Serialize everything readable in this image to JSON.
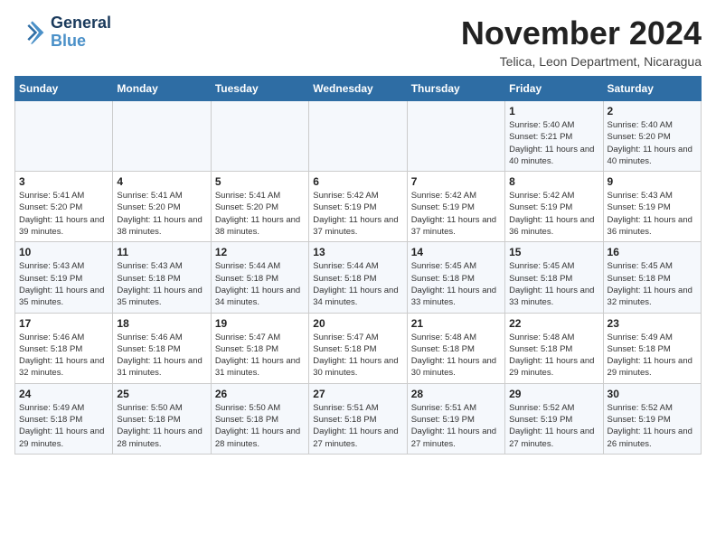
{
  "logo": {
    "line1": "General",
    "line2": "Blue"
  },
  "title": "November 2024",
  "subtitle": "Telica, Leon Department, Nicaragua",
  "weekdays": [
    "Sunday",
    "Monday",
    "Tuesday",
    "Wednesday",
    "Thursday",
    "Friday",
    "Saturday"
  ],
  "weeks": [
    [
      {
        "day": "",
        "info": ""
      },
      {
        "day": "",
        "info": ""
      },
      {
        "day": "",
        "info": ""
      },
      {
        "day": "",
        "info": ""
      },
      {
        "day": "",
        "info": ""
      },
      {
        "day": "1",
        "info": "Sunrise: 5:40 AM\nSunset: 5:21 PM\nDaylight: 11 hours and 40 minutes."
      },
      {
        "day": "2",
        "info": "Sunrise: 5:40 AM\nSunset: 5:20 PM\nDaylight: 11 hours and 40 minutes."
      }
    ],
    [
      {
        "day": "3",
        "info": "Sunrise: 5:41 AM\nSunset: 5:20 PM\nDaylight: 11 hours and 39 minutes."
      },
      {
        "day": "4",
        "info": "Sunrise: 5:41 AM\nSunset: 5:20 PM\nDaylight: 11 hours and 38 minutes."
      },
      {
        "day": "5",
        "info": "Sunrise: 5:41 AM\nSunset: 5:20 PM\nDaylight: 11 hours and 38 minutes."
      },
      {
        "day": "6",
        "info": "Sunrise: 5:42 AM\nSunset: 5:19 PM\nDaylight: 11 hours and 37 minutes."
      },
      {
        "day": "7",
        "info": "Sunrise: 5:42 AM\nSunset: 5:19 PM\nDaylight: 11 hours and 37 minutes."
      },
      {
        "day": "8",
        "info": "Sunrise: 5:42 AM\nSunset: 5:19 PM\nDaylight: 11 hours and 36 minutes."
      },
      {
        "day": "9",
        "info": "Sunrise: 5:43 AM\nSunset: 5:19 PM\nDaylight: 11 hours and 36 minutes."
      }
    ],
    [
      {
        "day": "10",
        "info": "Sunrise: 5:43 AM\nSunset: 5:19 PM\nDaylight: 11 hours and 35 minutes."
      },
      {
        "day": "11",
        "info": "Sunrise: 5:43 AM\nSunset: 5:18 PM\nDaylight: 11 hours and 35 minutes."
      },
      {
        "day": "12",
        "info": "Sunrise: 5:44 AM\nSunset: 5:18 PM\nDaylight: 11 hours and 34 minutes."
      },
      {
        "day": "13",
        "info": "Sunrise: 5:44 AM\nSunset: 5:18 PM\nDaylight: 11 hours and 34 minutes."
      },
      {
        "day": "14",
        "info": "Sunrise: 5:45 AM\nSunset: 5:18 PM\nDaylight: 11 hours and 33 minutes."
      },
      {
        "day": "15",
        "info": "Sunrise: 5:45 AM\nSunset: 5:18 PM\nDaylight: 11 hours and 33 minutes."
      },
      {
        "day": "16",
        "info": "Sunrise: 5:45 AM\nSunset: 5:18 PM\nDaylight: 11 hours and 32 minutes."
      }
    ],
    [
      {
        "day": "17",
        "info": "Sunrise: 5:46 AM\nSunset: 5:18 PM\nDaylight: 11 hours and 32 minutes."
      },
      {
        "day": "18",
        "info": "Sunrise: 5:46 AM\nSunset: 5:18 PM\nDaylight: 11 hours and 31 minutes."
      },
      {
        "day": "19",
        "info": "Sunrise: 5:47 AM\nSunset: 5:18 PM\nDaylight: 11 hours and 31 minutes."
      },
      {
        "day": "20",
        "info": "Sunrise: 5:47 AM\nSunset: 5:18 PM\nDaylight: 11 hours and 30 minutes."
      },
      {
        "day": "21",
        "info": "Sunrise: 5:48 AM\nSunset: 5:18 PM\nDaylight: 11 hours and 30 minutes."
      },
      {
        "day": "22",
        "info": "Sunrise: 5:48 AM\nSunset: 5:18 PM\nDaylight: 11 hours and 29 minutes."
      },
      {
        "day": "23",
        "info": "Sunrise: 5:49 AM\nSunset: 5:18 PM\nDaylight: 11 hours and 29 minutes."
      }
    ],
    [
      {
        "day": "24",
        "info": "Sunrise: 5:49 AM\nSunset: 5:18 PM\nDaylight: 11 hours and 29 minutes."
      },
      {
        "day": "25",
        "info": "Sunrise: 5:50 AM\nSunset: 5:18 PM\nDaylight: 11 hours and 28 minutes."
      },
      {
        "day": "26",
        "info": "Sunrise: 5:50 AM\nSunset: 5:18 PM\nDaylight: 11 hours and 28 minutes."
      },
      {
        "day": "27",
        "info": "Sunrise: 5:51 AM\nSunset: 5:18 PM\nDaylight: 11 hours and 27 minutes."
      },
      {
        "day": "28",
        "info": "Sunrise: 5:51 AM\nSunset: 5:19 PM\nDaylight: 11 hours and 27 minutes."
      },
      {
        "day": "29",
        "info": "Sunrise: 5:52 AM\nSunset: 5:19 PM\nDaylight: 11 hours and 27 minutes."
      },
      {
        "day": "30",
        "info": "Sunrise: 5:52 AM\nSunset: 5:19 PM\nDaylight: 11 hours and 26 minutes."
      }
    ]
  ]
}
